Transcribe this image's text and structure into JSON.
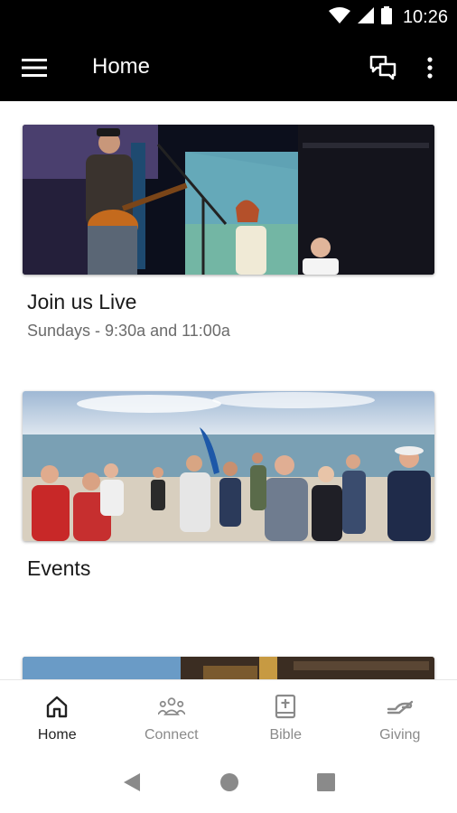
{
  "status": {
    "time": "10:26"
  },
  "app_bar": {
    "title": "Home"
  },
  "cards": [
    {
      "title": "Join us Live",
      "subtitle": "Sundays - 9:30a and 11:00a"
    },
    {
      "title": "Events"
    },
    {
      "title": ""
    }
  ],
  "bottom_nav": [
    {
      "label": "Home",
      "icon": "home-icon",
      "active": true
    },
    {
      "label": "Connect",
      "icon": "people-icon",
      "active": false
    },
    {
      "label": "Bible",
      "icon": "bible-icon",
      "active": false
    },
    {
      "label": "Giving",
      "icon": "giving-hand-icon",
      "active": false
    }
  ],
  "colors": {
    "app_bar": "#000000",
    "active_nav": "#222222",
    "inactive_nav": "#8a8a8a"
  }
}
